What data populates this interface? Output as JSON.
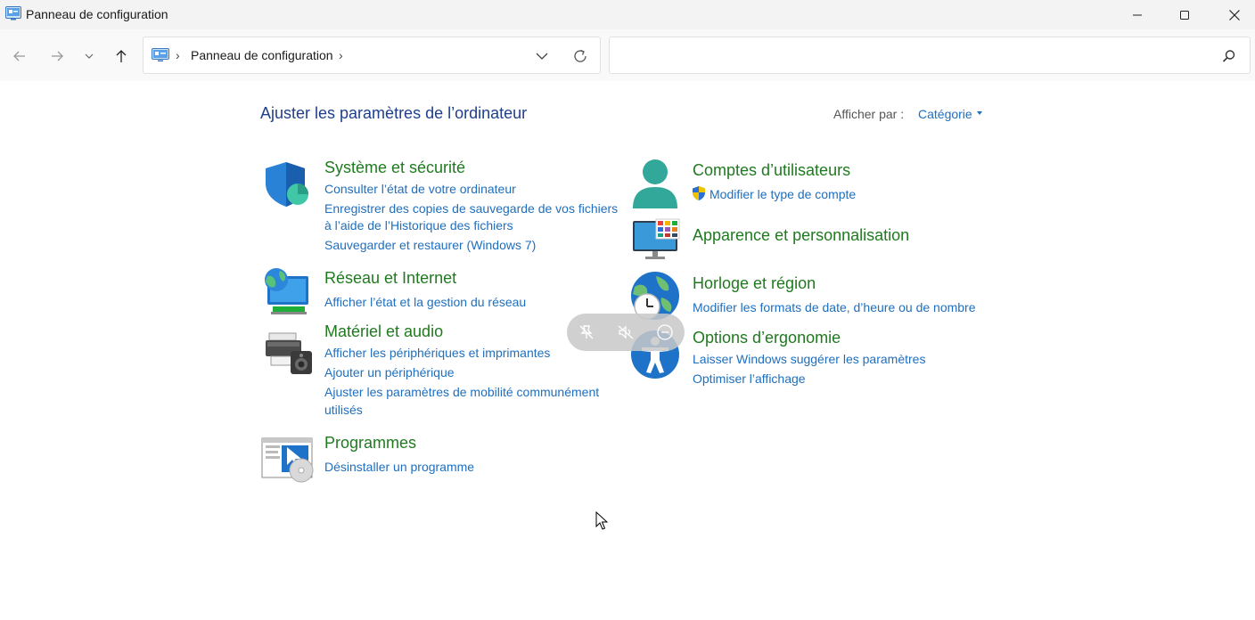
{
  "window": {
    "title": "Panneau de configuration"
  },
  "navigation": {
    "breadcrumb": "Panneau de configuration",
    "separator": "›",
    "search_placeholder": "",
    "search_value": ""
  },
  "main": {
    "heading": "Ajuster les paramètres de l’ordinateur",
    "view_by_label": "Afficher par :",
    "view_by_value": "Catégorie"
  },
  "categories": {
    "system": {
      "title": "Système et sécurité",
      "icon": "shield-icon",
      "links": [
        "Consulter l’état de votre ordinateur",
        "Enregistrer des copies de sauvegarde de vos fichiers",
        "à l’aide de l’Historique des fichiers",
        "Sauvegarder et restaurer (Windows 7)"
      ]
    },
    "network": {
      "title": "Réseau et Internet",
      "icon": "network-globe-icon",
      "links": [
        "Afficher l’état et la gestion du réseau"
      ]
    },
    "hardware": {
      "title": "Matériel et audio",
      "icon": "printer-speaker-icon",
      "links": [
        "Afficher les périphériques et imprimantes",
        "Ajouter un périphérique",
        "Ajuster les paramètres de mobilité communément",
        "utilisés"
      ]
    },
    "programs": {
      "title": "Programmes",
      "icon": "programs-disc-icon",
      "links": [
        "Désinstaller un programme"
      ]
    },
    "accounts": {
      "title": "Comptes d’utilisateurs",
      "icon": "user-icon",
      "links": [
        "Modifier le type de compte"
      ]
    },
    "appearance": {
      "title": "Apparence et personnalisation",
      "icon": "monitor-palette-icon",
      "links": []
    },
    "clock": {
      "title": "Horloge et région",
      "icon": "globe-clock-icon",
      "links": [
        "Modifier les formats de date, d’heure ou de nombre"
      ]
    },
    "ease": {
      "title": "Options d’ergonomie",
      "icon": "accessibility-icon",
      "links": [
        "Laisser Windows suggérer les paramètres",
        "Optimiser l’affichage"
      ]
    }
  },
  "colors": {
    "heading": "#1e3f8a",
    "category_title": "#1f7a1f",
    "link": "#1e6fbf"
  }
}
